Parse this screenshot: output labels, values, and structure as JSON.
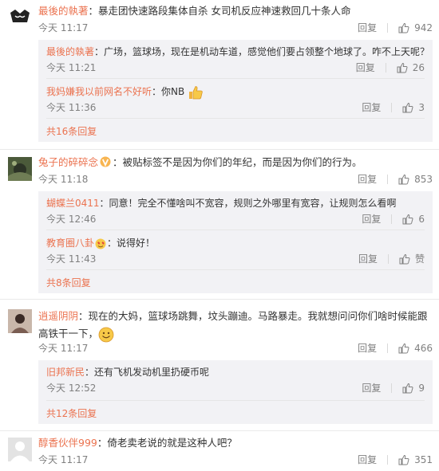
{
  "comments": [
    {
      "user": "最後的執著",
      "text": "：暴走团快速路段集体自杀 女司机反应神速救回几十条人命",
      "time": "今天 11:17",
      "reply_label": "回复",
      "likes": "942",
      "replies": [
        {
          "user": "最後的執著",
          "text": "：广场，篮球场，现在是机动车道，感觉他们要占领整个地球了。咋不上天呢？",
          "time": "今天 11:21",
          "reply_label": "回复",
          "likes": "26"
        },
        {
          "user": "我妈嫌我以前网名不好听",
          "text": "：你NB",
          "time": "今天 11:36",
          "reply_label": "回复",
          "likes": "3"
        }
      ],
      "more": "共16条回复"
    },
    {
      "user": "兔子的碎碎念",
      "text": "：被贴标签不是因为你们的年纪，而是因为你们的行为。",
      "time": "今天 11:18",
      "reply_label": "回复",
      "likes": "853",
      "replies": [
        {
          "user": "蝴蝶兰0411",
          "text": "：同意！完全不懂啥叫不宽容，规则之外哪里有宽容，让规则怎么看啊",
          "time": "今天 12:46",
          "reply_label": "回复",
          "likes": "6"
        },
        {
          "user": "教育圈八卦",
          "text": "：说得好！",
          "time": "今天 11:43",
          "reply_label": "回复",
          "likes": "赞"
        }
      ],
      "more": "共8条回复"
    },
    {
      "user": "逍遥阴阴",
      "text": "：现在的大妈，篮球场跳舞，坟头蹦迪。马路暴走。我就想问问你们啥时候能跟高铁干一下，",
      "time": "今天 11:17",
      "reply_label": "回复",
      "likes": "466",
      "replies": [
        {
          "user": "旧邦新民",
          "text": "：还有飞机发动机里扔硬币呢",
          "time": "今天 12:52",
          "reply_label": "回复",
          "likes": "9"
        }
      ],
      "more": "共12条回复"
    },
    {
      "user": "醇香伙伴999",
      "text": "：倚老卖老说的就是这种人吧？",
      "time": "今天 11:17",
      "reply_label": "回复",
      "likes": "351"
    }
  ],
  "colors": {
    "username": "#eb7350",
    "reply_bg": "#f2f2f5",
    "meta": "#808080"
  }
}
